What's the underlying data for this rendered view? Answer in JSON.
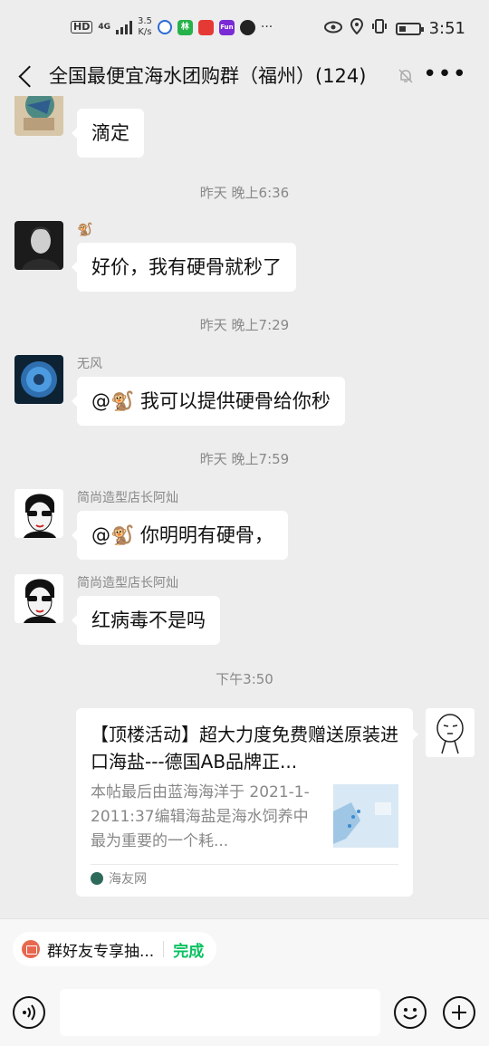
{
  "status_bar": {
    "hd": "HD",
    "network": "4G",
    "speed_value": "3.5",
    "speed_unit": "K/s",
    "app_icon_1": "林",
    "app_icon_2": "Fun",
    "time": "3:51"
  },
  "header": {
    "title": "全国最便宜海水团购群（福州）(124)"
  },
  "messages": [
    {
      "sender": "",
      "text": "滴定"
    },
    {
      "sender": "🐒",
      "text": "好价，我有硬骨就秒了"
    },
    {
      "sender": "无风",
      "text": "@🐒  我可以提供硬骨给你秒"
    },
    {
      "sender": "简尚造型店长阿灿",
      "text": "@🐒  你明明有硬骨，"
    },
    {
      "sender": "简尚造型店长阿灿",
      "text": "红病毒不是吗"
    }
  ],
  "timestamps": [
    "昨天 晚上6:36",
    "昨天 晚上7:29",
    "昨天 晚上7:59",
    "下午3:50"
  ],
  "link_card": {
    "title": "【顶楼活动】超大力度免费赠送原装进口海盐---德国AB品牌正...",
    "description": "本帖最后由蓝海海洋于 2021-1-2011:37编辑海盐是海水饲养中最为重要的一个耗...",
    "source": "海友网"
  },
  "bottom": {
    "chip_label": "群好友专享抽...",
    "chip_done": "完成",
    "input_placeholder": ""
  },
  "colors": {
    "background": "#ededed",
    "bubble": "#ffffff",
    "accent_green": "#07c160",
    "gift_red": "#e7684f"
  },
  "icons": {
    "back": "chevron-left-icon",
    "mute": "bell-off-icon",
    "more": "more-dots-icon",
    "voice": "voice-icon",
    "emoji": "emoji-icon",
    "plus": "plus-icon",
    "gift": "gift-icon"
  }
}
